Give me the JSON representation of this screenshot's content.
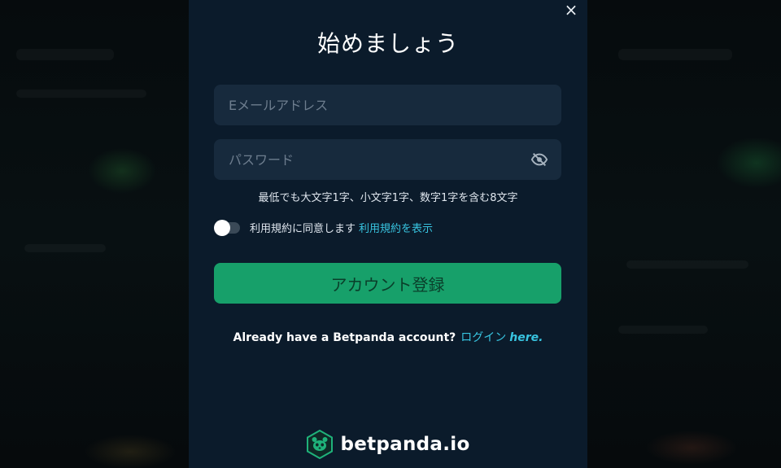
{
  "modal": {
    "title": "始めましょう",
    "close_label": "×"
  },
  "email": {
    "placeholder": "Eメールアドレス",
    "value": ""
  },
  "password": {
    "placeholder": "パスワード",
    "value": "",
    "visibility_icon": "eye-off-icon"
  },
  "password_hint": "最低でも大文字1字、小文字1字、数字1字を含む8文字",
  "terms": {
    "label": "利用規約に同意します",
    "link_label": "利用規約を表示",
    "accepted": false
  },
  "register_button": {
    "label": "アカウント登録"
  },
  "login_prompt": {
    "text": "Already have a Betpanda account?",
    "login_label": "ログイン",
    "here_label": "here."
  },
  "brand": {
    "name": "betpanda.io",
    "logo_icon": "panda-logo-icon"
  },
  "colors": {
    "modal_bg": "#0b1b2b",
    "field_bg": "#172a3d",
    "accent": "#17a06a",
    "link": "#38c4e0"
  }
}
